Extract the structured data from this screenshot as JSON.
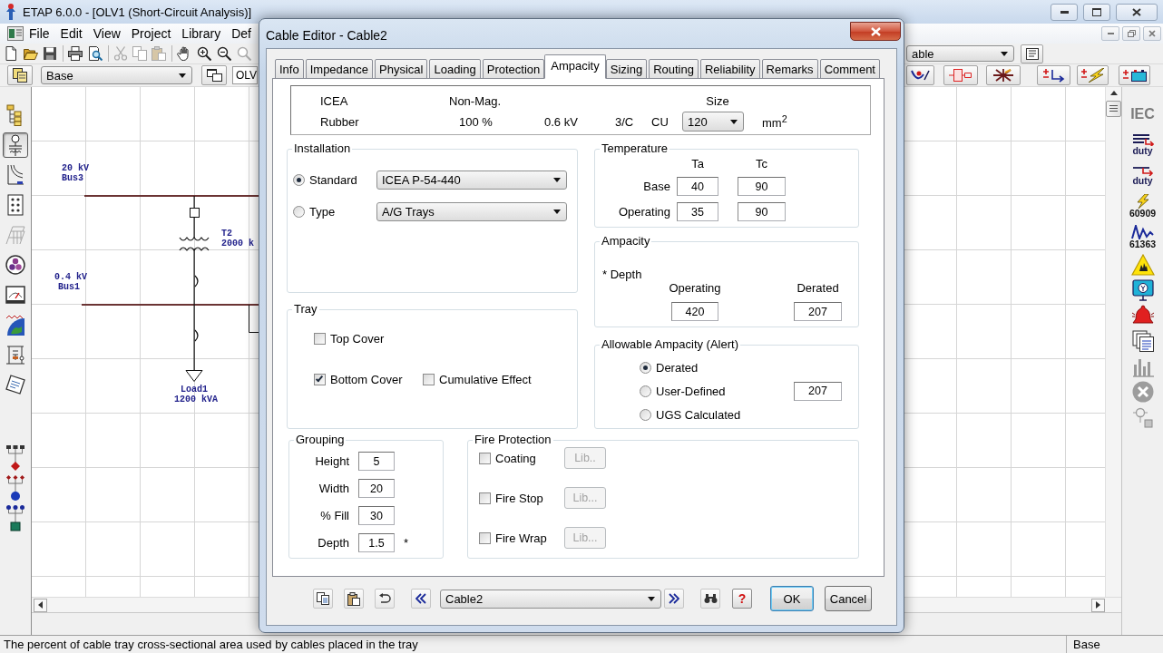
{
  "app": {
    "title": "ETAP 6.0.0 - [OLV1 (Short-Circuit Analysis)]",
    "menu": [
      "File",
      "Edit",
      "View",
      "Project",
      "Library",
      "Def"
    ],
    "presentation": "Base",
    "config": "OLV",
    "right_dropdown": "able"
  },
  "mode_toolbar": [
    {
      "kind": "tree",
      "selected": false
    },
    {
      "kind": "one_line",
      "selected": true
    },
    {
      "kind": "curves",
      "selected": false
    },
    {
      "kind": "panel",
      "selected": false
    },
    {
      "kind": "tray",
      "selected": false
    },
    {
      "kind": "circles",
      "selected": false
    },
    {
      "kind": "meter",
      "selected": false
    },
    {
      "kind": "globe",
      "selected": false
    },
    {
      "kind": "circuit",
      "selected": false
    },
    {
      "kind": "notes",
      "selected": false
    }
  ],
  "study_toolbar": [
    {
      "kind": "text",
      "label": "IEC"
    },
    {
      "kind": "duty_bus",
      "label": "duty"
    },
    {
      "kind": "duty_device",
      "label": "duty"
    },
    {
      "kind": "lightning",
      "label": "60909"
    },
    {
      "kind": "wave",
      "label": "61363"
    }
  ],
  "diagram": {
    "buses": [
      {
        "voltage": "20 kV",
        "name": "Bus3"
      },
      {
        "voltage": "0.4 kV",
        "name": "Bus1"
      }
    ],
    "transformer": {
      "name": "T2",
      "rating": "2000 k"
    },
    "load": {
      "name": "Load1",
      "rating": "1200 kVA"
    }
  },
  "dialog": {
    "title": "Cable Editor - Cable2",
    "tabs": [
      {
        "label": "Info",
        "selected": false
      },
      {
        "label": "Impedance",
        "selected": false
      },
      {
        "label": "Physical",
        "selected": false
      },
      {
        "label": "Loading",
        "selected": false
      },
      {
        "label": "Protection",
        "selected": false
      },
      {
        "label": "Ampacity",
        "selected": true
      },
      {
        "label": "Sizing",
        "selected": false
      },
      {
        "label": "Routing",
        "selected": false
      },
      {
        "label": "Reliability",
        "selected": false
      },
      {
        "label": "Remarks",
        "selected": false
      },
      {
        "label": "Comment",
        "selected": false
      }
    ],
    "summary": {
      "standard": "ICEA",
      "insulation": "Rubber",
      "magnetic": "Non-Mag.",
      "percent": "100 %",
      "voltage": "0.6 kV",
      "conductors": "3/C",
      "material": "CU",
      "size_label": "Size",
      "size": "120",
      "unit": "mm$^{2}$"
    },
    "installation": {
      "title": "Installation",
      "options": [
        {
          "label": "Standard",
          "selected": true,
          "value": "ICEA P-54-440"
        },
        {
          "label": "Type",
          "selected": false,
          "value": "A/G Trays"
        }
      ]
    },
    "tray": {
      "title": "Tray",
      "rows": [
        [
          {
            "label": "Top Cover",
            "checked": false
          }
        ],
        [
          {
            "label": "Bottom Cover",
            "checked": true
          },
          {
            "label": "Cumulative Effect",
            "checked": false
          }
        ]
      ]
    },
    "temperature": {
      "title": "Temperature",
      "columns": [
        "Ta",
        "Tc"
      ],
      "rows": [
        {
          "label": "Base",
          "values": [
            "40",
            "90"
          ]
        },
        {
          "label": "Operating",
          "values": [
            "35",
            "90"
          ]
        }
      ]
    },
    "ampacity": {
      "title": "Ampacity",
      "note": "* Depth",
      "columns": [
        {
          "label": "Operating",
          "value": "420"
        },
        {
          "label": "Derated",
          "value": "207"
        }
      ]
    },
    "allowable_ampacity": {
      "title": "Allowable Ampacity (Alert)",
      "options": [
        {
          "label": "Derated",
          "selected": true
        },
        {
          "label": "User-Defined",
          "selected": false,
          "value": "207"
        },
        {
          "label": "UGS Calculated",
          "selected": false
        }
      ]
    },
    "grouping": {
      "title": "Grouping",
      "fields": [
        {
          "label": "Height",
          "value": "5"
        },
        {
          "label": "Width",
          "value": "20"
        },
        {
          "label": "% Fill",
          "value": "30"
        },
        {
          "label": "Depth",
          "value": "1.5",
          "note": "*"
        }
      ]
    },
    "fire_protection": {
      "title": "Fire Protection",
      "items": [
        {
          "label": "Coating",
          "checked": false,
          "button": "Lib..",
          "button_disabled": true
        },
        {
          "label": "Fire Stop",
          "checked": false,
          "button": "Lib...",
          "button_disabled": true
        },
        {
          "label": "Fire Wrap",
          "checked": false,
          "button": "Lib...",
          "button_disabled": true
        }
      ]
    },
    "footer": {
      "element": "Cable2",
      "help": "?",
      "buttons": [
        {
          "label": "OK",
          "default": true
        },
        {
          "label": "Cancel",
          "default": false
        }
      ]
    }
  },
  "status_bar": {
    "message": "The percent of cable tray cross-sectional area used by cables placed in the tray",
    "mode": "Base"
  }
}
